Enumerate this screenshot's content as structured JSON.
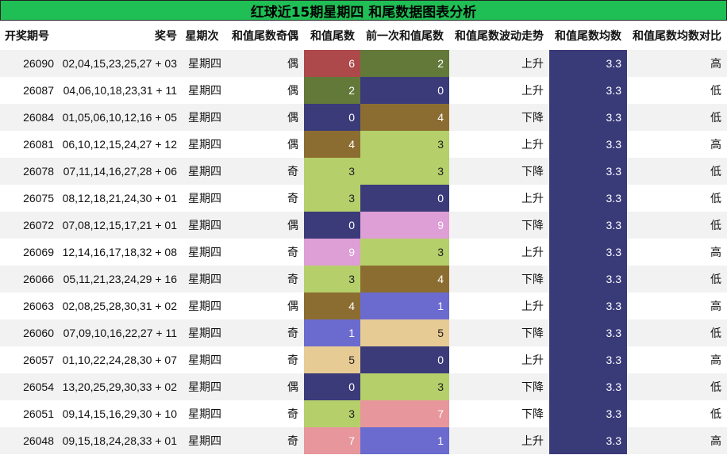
{
  "title": "红球近15期星期四 和尾数据图表分析",
  "headers": [
    "开奖期号",
    "奖号",
    "星期次",
    "和值尾数奇偶",
    "和值尾数",
    "前一次和值尾数",
    "和值尾数波动走势",
    "和值尾数均数",
    "和值尾数均数对比"
  ],
  "colors": {
    "0": "#3b3b7a",
    "1": "#6b6bcf",
    "2": "#637939",
    "3": "#b5cf6b",
    "4": "#8c6d31",
    "5": "#e7cb94",
    "6": "#ad494a",
    "7": "#e7969c",
    "9": "#de9ed6",
    "avg": "#393b79"
  },
  "rows": [
    {
      "issue": "26090",
      "numbers": "02,04,15,23,25,27 + 03",
      "weekday": "星期四",
      "parity": "偶",
      "tail": "6",
      "prev": "2",
      "trend": "上升",
      "avg": "3.3",
      "compare": "高"
    },
    {
      "issue": "26087",
      "numbers": "04,06,10,18,23,31 + 11",
      "weekday": "星期四",
      "parity": "偶",
      "tail": "2",
      "prev": "0",
      "trend": "上升",
      "avg": "3.3",
      "compare": "低"
    },
    {
      "issue": "26084",
      "numbers": "01,05,06,10,12,16 + 05",
      "weekday": "星期四",
      "parity": "偶",
      "tail": "0",
      "prev": "4",
      "trend": "下降",
      "avg": "3.3",
      "compare": "低"
    },
    {
      "issue": "26081",
      "numbers": "06,10,12,15,24,27 + 12",
      "weekday": "星期四",
      "parity": "偶",
      "tail": "4",
      "prev": "3",
      "trend": "上升",
      "avg": "3.3",
      "compare": "高"
    },
    {
      "issue": "26078",
      "numbers": "07,11,14,16,27,28 + 06",
      "weekday": "星期四",
      "parity": "奇",
      "tail": "3",
      "prev": "3",
      "trend": "下降",
      "avg": "3.3",
      "compare": "低"
    },
    {
      "issue": "26075",
      "numbers": "08,12,18,21,24,30 + 01",
      "weekday": "星期四",
      "parity": "奇",
      "tail": "3",
      "prev": "0",
      "trend": "上升",
      "avg": "3.3",
      "compare": "低"
    },
    {
      "issue": "26072",
      "numbers": "07,08,12,15,17,21 + 01",
      "weekday": "星期四",
      "parity": "偶",
      "tail": "0",
      "prev": "9",
      "trend": "下降",
      "avg": "3.3",
      "compare": "低"
    },
    {
      "issue": "26069",
      "numbers": "12,14,16,17,18,32 + 08",
      "weekday": "星期四",
      "parity": "奇",
      "tail": "9",
      "prev": "3",
      "trend": "上升",
      "avg": "3.3",
      "compare": "高"
    },
    {
      "issue": "26066",
      "numbers": "05,11,21,23,24,29 + 16",
      "weekday": "星期四",
      "parity": "奇",
      "tail": "3",
      "prev": "4",
      "trend": "下降",
      "avg": "3.3",
      "compare": "低"
    },
    {
      "issue": "26063",
      "numbers": "02,08,25,28,30,31 + 02",
      "weekday": "星期四",
      "parity": "偶",
      "tail": "4",
      "prev": "1",
      "trend": "上升",
      "avg": "3.3",
      "compare": "高"
    },
    {
      "issue": "26060",
      "numbers": "07,09,10,16,22,27 + 11",
      "weekday": "星期四",
      "parity": "奇",
      "tail": "1",
      "prev": "5",
      "trend": "下降",
      "avg": "3.3",
      "compare": "低"
    },
    {
      "issue": "26057",
      "numbers": "01,10,22,24,28,30 + 07",
      "weekday": "星期四",
      "parity": "奇",
      "tail": "5",
      "prev": "0",
      "trend": "上升",
      "avg": "3.3",
      "compare": "高"
    },
    {
      "issue": "26054",
      "numbers": "13,20,25,29,30,33 + 02",
      "weekday": "星期四",
      "parity": "偶",
      "tail": "0",
      "prev": "3",
      "trend": "下降",
      "avg": "3.3",
      "compare": "低"
    },
    {
      "issue": "26051",
      "numbers": "09,14,15,16,29,30 + 10",
      "weekday": "星期四",
      "parity": "奇",
      "tail": "3",
      "prev": "7",
      "trend": "下降",
      "avg": "3.3",
      "compare": "低"
    },
    {
      "issue": "26048",
      "numbers": "09,15,18,24,28,33 + 01",
      "weekday": "星期四",
      "parity": "奇",
      "tail": "7",
      "prev": "1",
      "trend": "上升",
      "avg": "3.3",
      "compare": "高"
    }
  ]
}
